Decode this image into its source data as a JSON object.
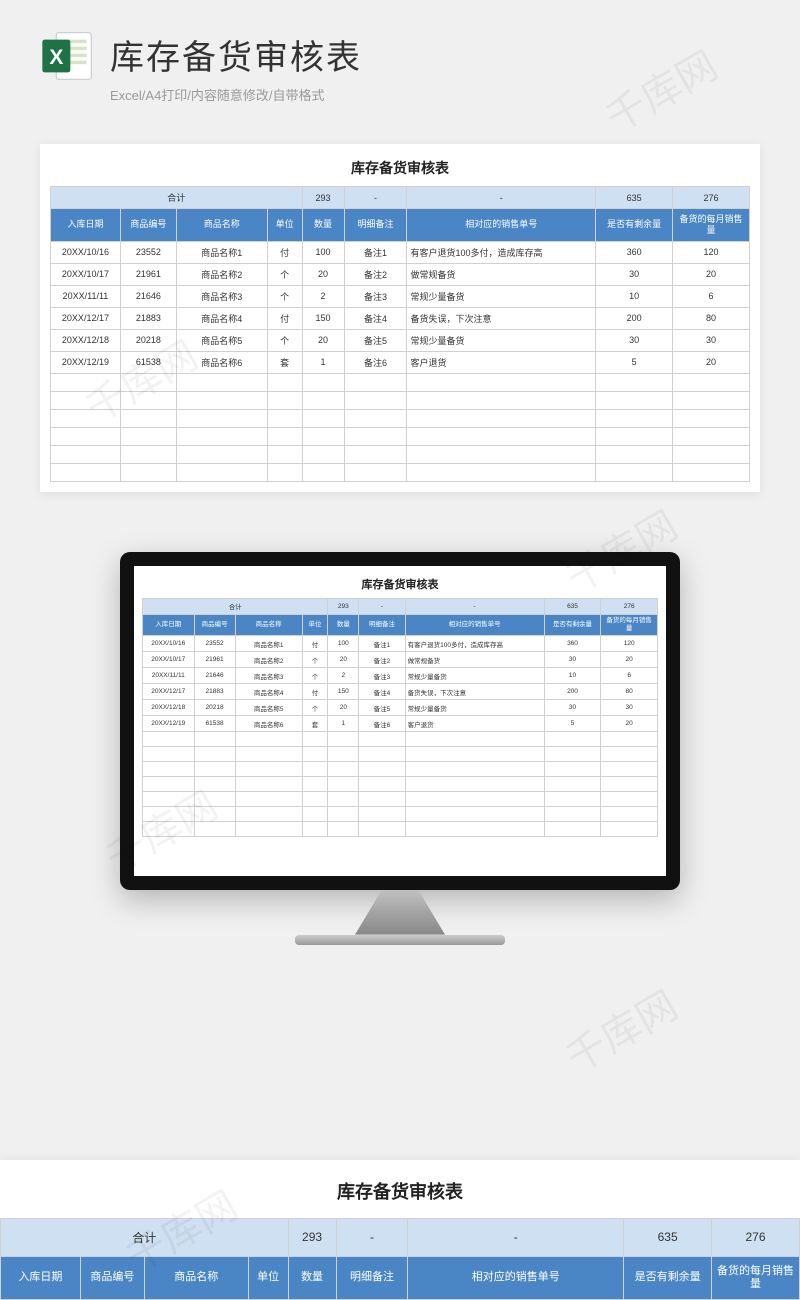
{
  "hero": {
    "title": "库存备货审核表",
    "subtitle": "Excel/A4打印/内容随意修改/自带格式"
  },
  "sheet": {
    "title": "库存备货审核表",
    "summary": {
      "label": "合计",
      "qty": "293",
      "note_dash": "-",
      "sale_dash": "-",
      "remain": "635",
      "monthly": "276"
    },
    "headers": {
      "date": "入库日期",
      "code": "商品编号",
      "name": "商品名称",
      "unit": "单位",
      "qty": "数量",
      "note": "明细备注",
      "sale": "相对应的销售单号",
      "remain": "是否有剩余量",
      "monthly": "备货的每月销售量"
    },
    "rows": [
      {
        "date": "20XX/10/16",
        "code": "23552",
        "name": "商品名称1",
        "unit": "付",
        "qty": "100",
        "note": "备注1",
        "sale": "有客户退货100多付，造成库存高",
        "remain": "360",
        "monthly": "120"
      },
      {
        "date": "20XX/10/17",
        "code": "21961",
        "name": "商品名称2",
        "unit": "个",
        "qty": "20",
        "note": "备注2",
        "sale": "做常规备货",
        "remain": "30",
        "monthly": "20"
      },
      {
        "date": "20XX/11/11",
        "code": "21646",
        "name": "商品名称3",
        "unit": "个",
        "qty": "2",
        "note": "备注3",
        "sale": "常规少量备货",
        "remain": "10",
        "monthly": "6"
      },
      {
        "date": "20XX/12/17",
        "code": "21883",
        "name": "商品名称4",
        "unit": "付",
        "qty": "150",
        "note": "备注4",
        "sale": "备货失误，下次注意",
        "remain": "200",
        "monthly": "80"
      },
      {
        "date": "20XX/12/18",
        "code": "20218",
        "name": "商品名称5",
        "unit": "个",
        "qty": "20",
        "note": "备注5",
        "sale": "常规少量备货",
        "remain": "30",
        "monthly": "30"
      },
      {
        "date": "20XX/12/19",
        "code": "61538",
        "name": "商品名称6",
        "unit": "套",
        "qty": "1",
        "note": "备注6",
        "sale": "客户退货",
        "remain": "5",
        "monthly": "20"
      }
    ]
  },
  "watermark": "千库网"
}
